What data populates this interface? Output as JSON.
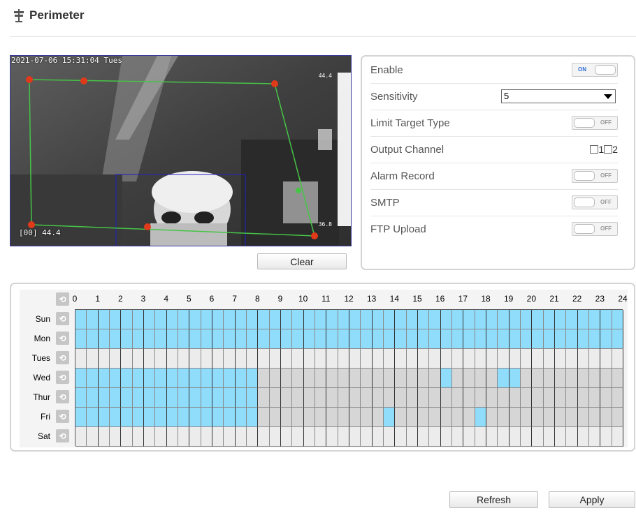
{
  "page": {
    "title": "Perimeter",
    "icon": "perimeter-sign-icon"
  },
  "video": {
    "timestamp": "2021-07-06 15:31:04 Tues",
    "channel_temp": "[00] 44.4",
    "scale_top": "44.4",
    "scale_bottom": "36.8"
  },
  "buttons": {
    "clear": "Clear",
    "refresh": "Refresh",
    "apply": "Apply"
  },
  "settings": {
    "enable": {
      "label": "Enable",
      "state": "ON"
    },
    "sensitivity": {
      "label": "Sensitivity",
      "value": "5"
    },
    "limit_target_type": {
      "label": "Limit Target Type",
      "state": "OFF"
    },
    "output_channel": {
      "label": "Output Channel",
      "options": [
        "1",
        "2"
      ]
    },
    "alarm_record": {
      "label": "Alarm Record",
      "state": "OFF"
    },
    "smtp": {
      "label": "SMTP",
      "state": "OFF"
    },
    "ftp_upload": {
      "label": "FTP Upload",
      "state": "OFF"
    }
  },
  "schedule": {
    "hours": [
      "0",
      "1",
      "2",
      "3",
      "4",
      "5",
      "6",
      "7",
      "8",
      "9",
      "10",
      "11",
      "12",
      "13",
      "14",
      "15",
      "16",
      "17",
      "18",
      "19",
      "20",
      "21",
      "22",
      "23",
      "24"
    ],
    "days": [
      {
        "label": "Sun",
        "slots": "111111111111111111111111111111111111111111111111"
      },
      {
        "label": "Mon",
        "slots": "111111111111111111111111111111111111111111111111"
      },
      {
        "label": "Tues",
        "slots": "000000000000000000000000000000000000000000000000"
      },
      {
        "label": "Wed",
        "slots": "111111111111111100000000000000000000000000000000"
      },
      {
        "label": "Thur",
        "slots": "111111111111111100000000000000000000000000000000"
      },
      {
        "label": "Fri",
        "slots": "111111111111111100000000000000000000000000000000"
      },
      {
        "label": "Sat",
        "slots": "000000000000000000000000000000000000000000000000"
      }
    ],
    "extra_selected": [
      {
        "day": 3,
        "slot": 32
      },
      {
        "day": 3,
        "slot": 37
      },
      {
        "day": 3,
        "slot": 38
      },
      {
        "day": 5,
        "slot": 27
      },
      {
        "day": 5,
        "slot": 35
      }
    ],
    "colors": {
      "selected": "#8fdcfb",
      "unselected_light": "#ececec",
      "unselected_dark": "#d6d6d6"
    }
  }
}
